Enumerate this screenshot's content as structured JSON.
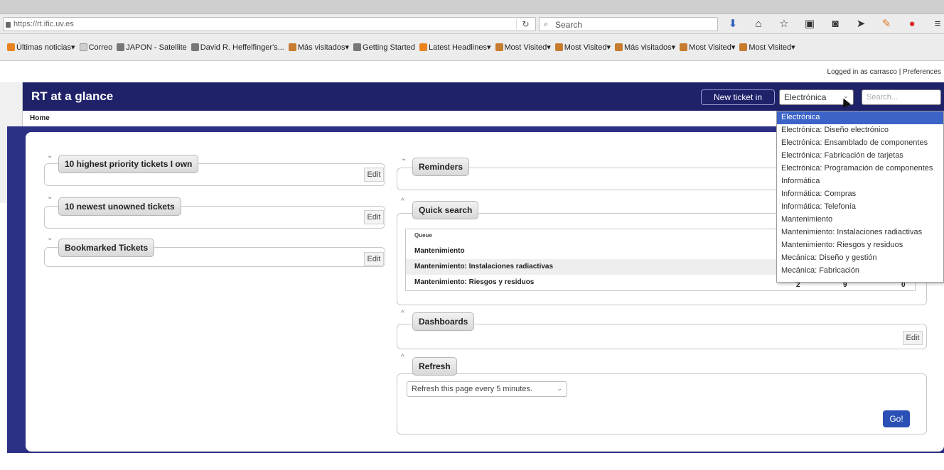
{
  "browser": {
    "url": "https://rt.ific.uv.es",
    "search_placeholder": "Search",
    "bookmarks": [
      {
        "label": "Últimas noticias",
        "icon": "rss-icon"
      },
      {
        "label": "Correo",
        "icon": "mail-icon"
      },
      {
        "label": "JAPON - Satellite",
        "icon": "globe-icon"
      },
      {
        "label": "David R. Heffelfinger's...",
        "icon": "globe-icon"
      },
      {
        "label": "Más visitados",
        "icon": "folder-icon"
      },
      {
        "label": "Getting Started",
        "icon": "globe-icon"
      },
      {
        "label": "Latest Headlines",
        "icon": "rss-icon"
      },
      {
        "label": "Most Visited",
        "icon": "folder-icon"
      },
      {
        "label": "Most Visited",
        "icon": "folder-icon"
      },
      {
        "label": "Más visitados",
        "icon": "folder-icon"
      },
      {
        "label": "Most Visited",
        "icon": "folder-icon"
      },
      {
        "label": "Most Visited",
        "icon": "folder-icon"
      }
    ]
  },
  "rt": {
    "logged_in": "Logged in as carrasco | Preferences",
    "title": "RT at a glance",
    "new_ticket_label": "New ticket in",
    "queue_selected": "Electrónica",
    "search_placeholder": "Search...",
    "breadcrumb": "Home",
    "edit_label": "Edit",
    "portlets": {
      "highest_priority": "10 highest priority tickets I own",
      "newest_unowned": "10 newest unowned tickets",
      "bookmarked": "Bookmarked Tickets",
      "reminders": "Reminders",
      "quick_search": "Quick search",
      "dashboards": "Dashboards",
      "refresh": "Refresh"
    },
    "quick_search_table": {
      "header": "Queue",
      "rows": [
        "Mantenimiento",
        "Mantenimiento: Instalaciones radiactivas",
        "Mantenimiento: Riesgos y residuos"
      ],
      "counts": [
        "2",
        "9",
        "0"
      ]
    },
    "refresh_select": "Refresh this page every 5 minutes.",
    "go_label": "Go!",
    "queue_options": [
      "Electrónica",
      "Electrónica: Diseño electrónico",
      "Electrónica: Ensamblado de componentes",
      "Electrónica: Fabricación de tarjetas",
      "Electrónica: Programación de componentes",
      "Informática",
      "Informática: Compras",
      "Informática: Telefonía",
      "Mantenimiento",
      "Mantenimiento: Instalaciones radiactivas",
      "Mantenimiento: Riesgos y residuos",
      "Mecánica: Diseño y gestión",
      "Mecánica: Fabricación"
    ]
  },
  "colors": {
    "header": "#1f2269",
    "panel": "#2d3185",
    "selected_option": "#3b63c8",
    "go_button": "#2a4fb5"
  }
}
